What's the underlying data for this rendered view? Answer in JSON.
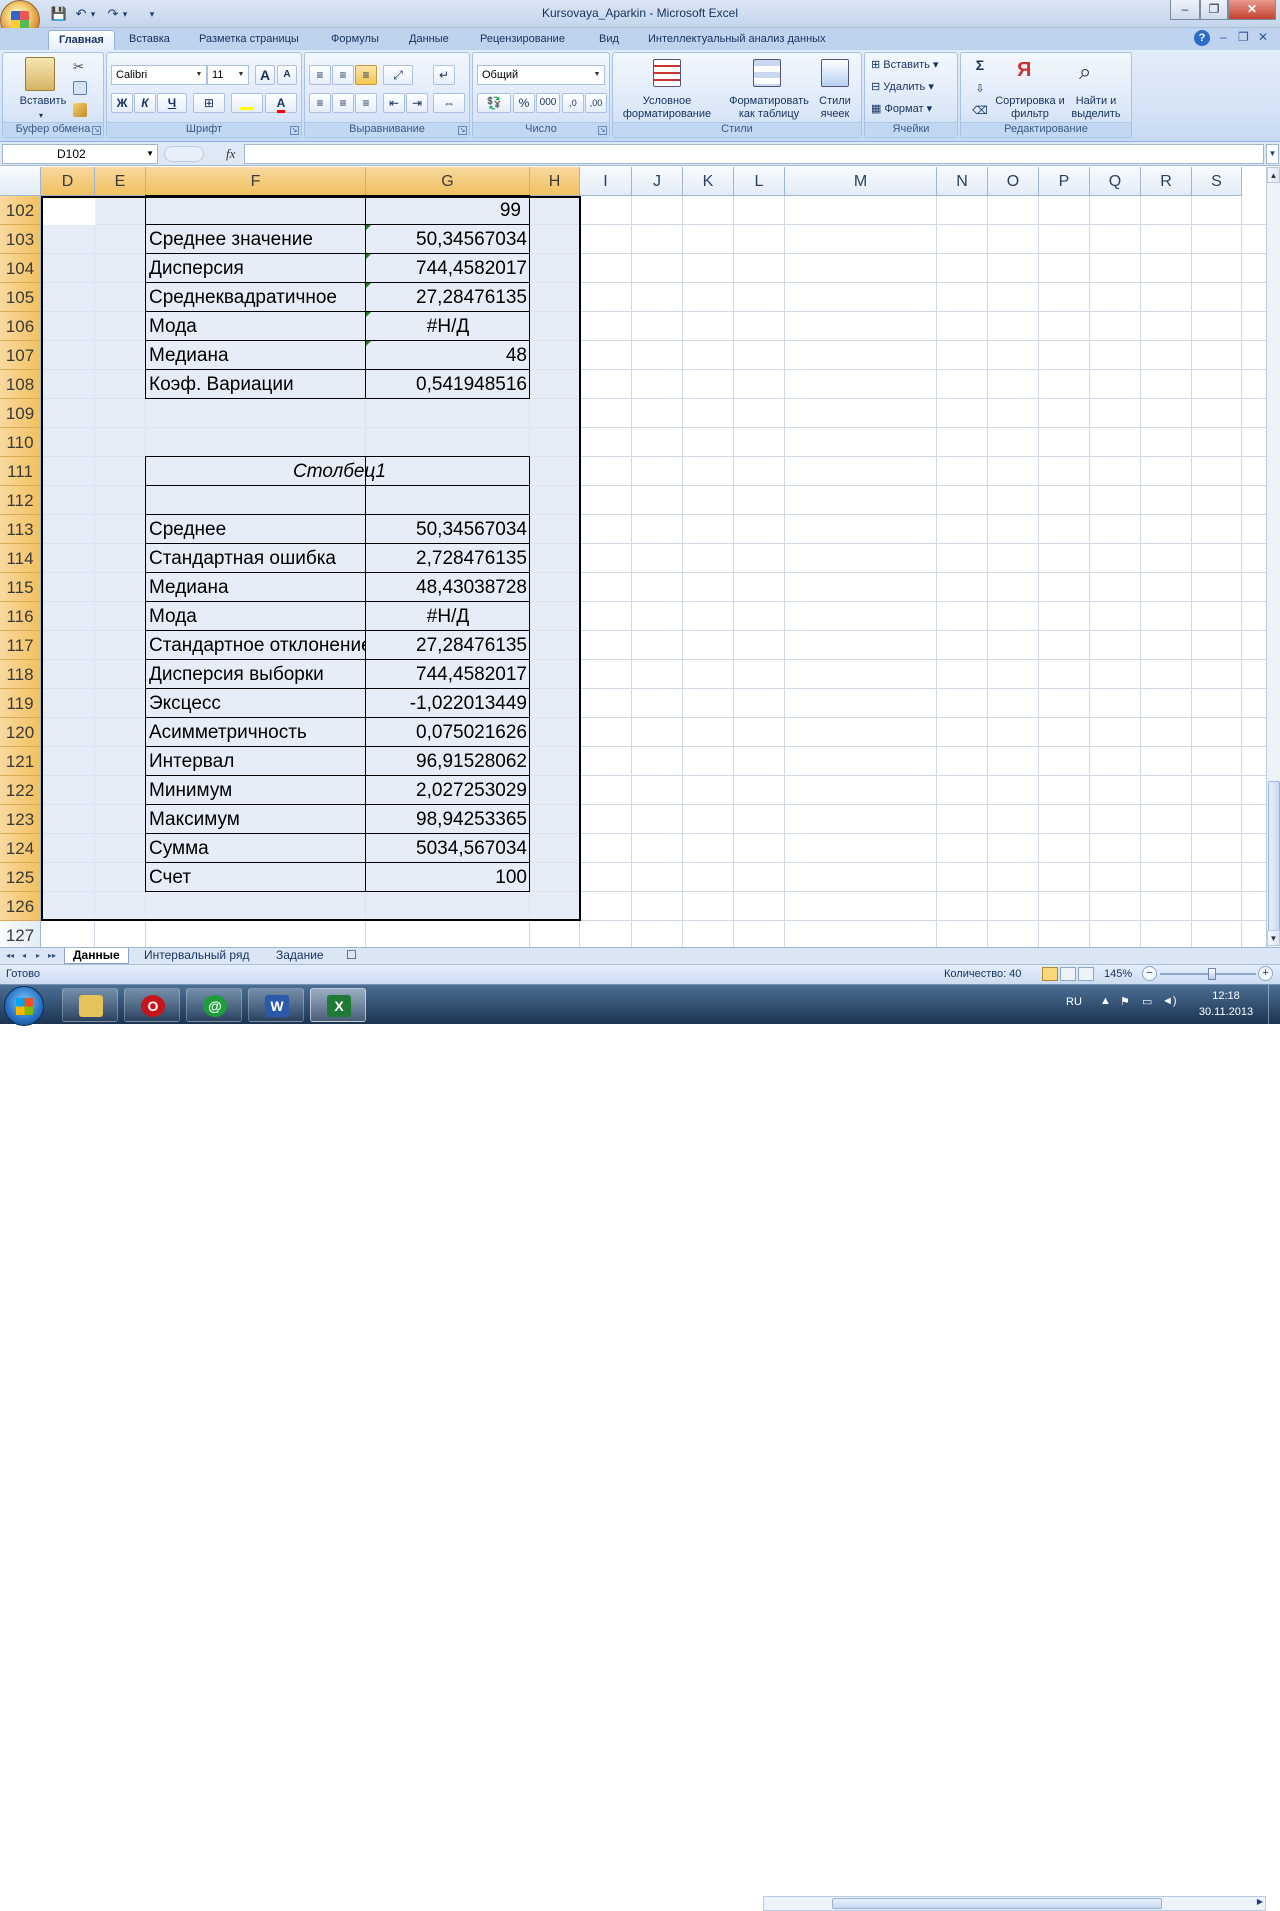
{
  "window": {
    "title": "Kursovaya_Aparkin - Microsoft Excel",
    "qat": {
      "save_icon": "save-icon",
      "undo_icon": "undo-icon",
      "redo_icon": "redo-icon",
      "undo_dd": "▾",
      "redo_dd": "▾",
      "customize": "▾"
    },
    "controls": {
      "minimize": "–",
      "restore": "❐",
      "close": "✕"
    }
  },
  "ribbon": {
    "tabs": [
      "Главная",
      "Вставка",
      "Разметка страницы",
      "Формулы",
      "Данные",
      "Рецензирование",
      "Вид",
      "Интеллектуальный анализ данных"
    ],
    "active_tab": "Главная",
    "help": {
      "help": "?",
      "minimize": "–",
      "restore": "❐",
      "close": "✕"
    },
    "groups": {
      "clipboard": {
        "label": "Буфер обмена",
        "paste": "Вставить"
      },
      "font": {
        "label": "Шрифт",
        "font_name": "Calibri",
        "font_size": "11",
        "grow": "A",
        "shrink": "A",
        "bold": "Ж",
        "italic": "К",
        "underline": "Ч",
        "fill_color": "#ffff00",
        "font_color": "#ff0000",
        "font_color_label": "A"
      },
      "alignment": {
        "label": "Выравнивание"
      },
      "number": {
        "label": "Число",
        "format": "Общий",
        "percent": "%",
        "thousands": "000",
        "inc_dec": ",0",
        "dec_dec": ",00"
      },
      "styles": {
        "label": "Стили",
        "conditional": "Условное форматирование",
        "as_table": "Форматировать как таблицу",
        "cell_styles": "Стили ячеек"
      },
      "cells": {
        "label": "Ячейки",
        "insert": "Вставить",
        "delete": "Удалить",
        "format": "Формат"
      },
      "editing": {
        "label": "Редактирование",
        "sigma": "Σ",
        "sort": "Сортировка и фильтр",
        "find": "Найти и выделить"
      }
    }
  },
  "formula_bar": {
    "name_box": "D102",
    "fx": "fx",
    "value": ""
  },
  "grid": {
    "columns": [
      "D",
      "E",
      "F",
      "G",
      "H",
      "I",
      "J",
      "K",
      "L",
      "M",
      "N",
      "O",
      "P",
      "Q",
      "R",
      "S"
    ],
    "rows": [
      "102",
      "103",
      "104",
      "105",
      "106",
      "107",
      "108",
      "109",
      "110",
      "111",
      "112",
      "113",
      "114",
      "115",
      "116",
      "117",
      "118",
      "119",
      "120",
      "121",
      "122",
      "123",
      "124",
      "125",
      "126",
      "127"
    ],
    "cells": {
      "g102": "99",
      "f103": "Среднее значение",
      "g103": "50,34567034",
      "f104": "Дисперсия",
      "g104": "744,4582017",
      "f105": "Среднеквадратичное",
      "g105": "27,28476135",
      "f106": "Мода",
      "g106": "#Н/Д",
      "f107": "Медиана",
      "g107": "48",
      "f108": "Коэф. Вариации",
      "g108": "0,541948516",
      "f111": "Столбец1",
      "f113": "Среднее",
      "g113": "50,34567034",
      "f114": "Стандартная ошибка",
      "g114": "2,728476135",
      "f115": "Медиана",
      "g115": "48,43038728",
      "f116": "Мода",
      "g116": "#Н/Д",
      "f117": "Стандартное отклонение",
      "g117": "27,28476135",
      "f118": "Дисперсия выборки",
      "g118": "744,4582017",
      "f119": "Эксцесс",
      "g119": "-1,022013449",
      "f120": "Асимметричность",
      "g120": "0,075021626",
      "f121": "Интервал",
      "g121": "96,91528062",
      "f122": "Минимум",
      "g122": "2,027253029",
      "f123": "Максимум",
      "g123": "98,94253365",
      "f124": "Сумма",
      "g124": "5034,567034",
      "f125": "Счет",
      "g125": "100"
    }
  },
  "sheets": {
    "tabs": [
      "Данные",
      "Интервальный ряд",
      "Задание"
    ],
    "active": "Данные",
    "nav": [
      "◂◂",
      "◂",
      "▸",
      "▸▸"
    ]
  },
  "status": {
    "ready": "Готово",
    "count": "Количество: 40",
    "zoom": "145%",
    "zoom_out": "−",
    "zoom_in": "+"
  },
  "taskbar": {
    "lang": "RU",
    "time": "12:18",
    "date": "30.11.2013",
    "apps": [
      "explorer-icon",
      "opera-icon",
      "mail-agent-icon",
      "word-icon",
      "excel-icon"
    ]
  }
}
